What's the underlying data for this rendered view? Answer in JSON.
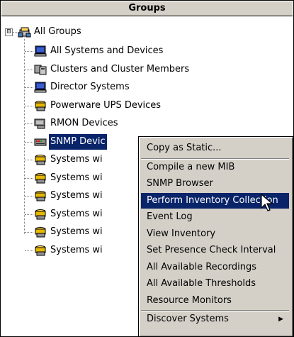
{
  "panel": {
    "title": "Groups"
  },
  "tree": {
    "root": {
      "label": "All Groups",
      "expander": "⊟",
      "icon": "groups-icon"
    },
    "children": [
      {
        "label": "All Systems and Devices",
        "icon": "monitor-icon"
      },
      {
        "label": "Clusters and Cluster Members",
        "icon": "cluster-icon"
      },
      {
        "label": "Director Systems",
        "icon": "monitor-icon"
      },
      {
        "label": "Powerware UPS Devices",
        "icon": "device-group-icon"
      },
      {
        "label": "RMON Devices",
        "icon": "rmon-icon"
      },
      {
        "label": "SNMP Devic",
        "icon": "snmp-icon",
        "selected": true
      },
      {
        "label": "Systems wi",
        "icon": "device-group-icon"
      },
      {
        "label": "Systems wi",
        "icon": "device-group-icon"
      },
      {
        "label": "Systems wi",
        "icon": "device-group-icon"
      },
      {
        "label": "Systems wi",
        "icon": "device-group-icon"
      },
      {
        "label": "Systems wi",
        "icon": "device-group-icon"
      },
      {
        "label": "Systems wi",
        "icon": "device-group-icon"
      }
    ]
  },
  "context_menu": {
    "items": [
      {
        "label": "Copy as Static..."
      },
      {
        "label": "Compile a new MIB"
      },
      {
        "label": "SNMP Browser"
      },
      {
        "label": "Perform Inventory Collection",
        "highlighted": true
      },
      {
        "label": "Event Log"
      },
      {
        "label": "View Inventory"
      },
      {
        "label": "Set Presence Check Interval"
      },
      {
        "label": "All Available Recordings"
      },
      {
        "label": "All Available Thresholds"
      },
      {
        "label": "Resource Monitors"
      },
      {
        "label": "Discover Systems",
        "has_submenu": true
      }
    ],
    "submenu_arrow": "▶"
  },
  "colors": {
    "selection": "#0a246a",
    "menu_bg": "#d4d0c8"
  }
}
